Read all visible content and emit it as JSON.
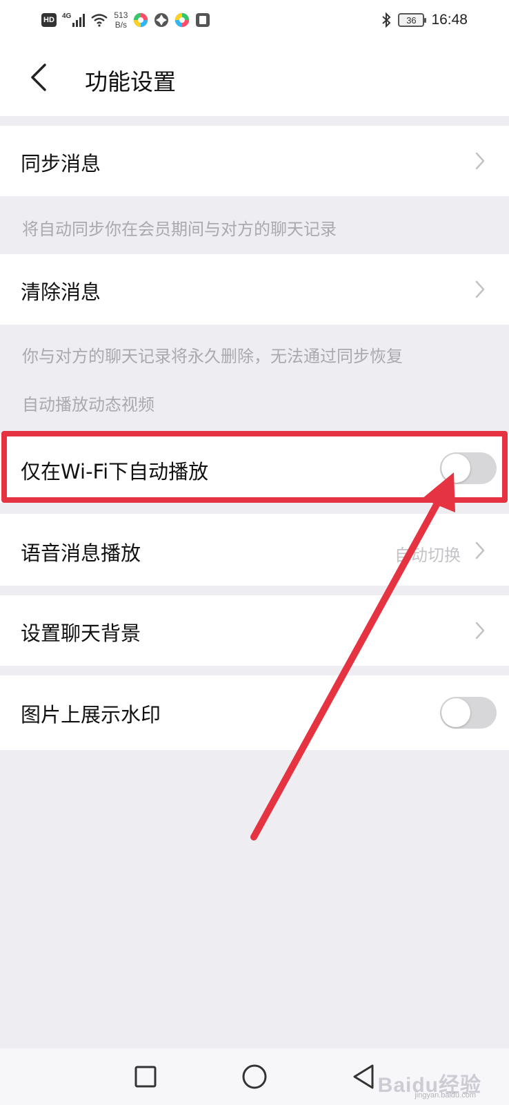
{
  "status_bar": {
    "hd": "HD",
    "network": "4G",
    "speed_value": "513",
    "speed_unit": "B/s",
    "battery": "36",
    "time": "16:48"
  },
  "header": {
    "title": "功能设置"
  },
  "rows": {
    "sync_messages": {
      "label": "同步消息"
    },
    "sync_hint": "将自动同步你在会员期间与对方的聊天记录",
    "clear_messages": {
      "label": "清除消息"
    },
    "clear_hint": "你与对方的聊天记录将永久删除，无法通过同步恢复",
    "autoplay_section": "自动播放动态视频",
    "wifi_autoplay": {
      "label": "仅在Wi-Fi下自动播放",
      "enabled": false
    },
    "voice_playback": {
      "label": "语音消息播放",
      "value": "自动切换"
    },
    "chat_background": {
      "label": "设置聊天背景"
    },
    "image_watermark": {
      "label": "图片上展示水印",
      "enabled": false
    }
  },
  "annotation": {
    "highlight_color": "#e53341"
  },
  "watermark": {
    "text": "Baidu经验",
    "sub": "jingyan.baidu.com"
  }
}
